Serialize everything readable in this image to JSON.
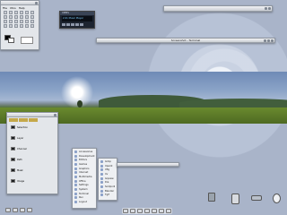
{
  "wallpaper": {
    "accent": "#c3cbe0"
  },
  "gimp_toolbox": {
    "menu": [
      "File",
      "Xtns",
      "Help"
    ],
    "icons": [
      "select-rect-icon",
      "select-ellipse-icon",
      "lasso-icon",
      "magic-wand-icon",
      "scissors-icon",
      "paths-icon",
      "zoom-icon",
      "measure-icon",
      "move-icon",
      "crop-icon",
      "rotate-icon",
      "flip-icon",
      "text-icon",
      "color-picker-icon",
      "bucket-icon",
      "gradient-icon",
      "pencil-icon",
      "brush-icon",
      "eraser-icon",
      "airbrush-icon",
      "clone-icon",
      "smudge-icon",
      "dodge-icon",
      "ink-icon"
    ]
  },
  "media_player": {
    "title": "XMMS",
    "display": "2:41 Music Player"
  },
  "top_bar_window": {
    "title": ""
  },
  "wide_window": {
    "title": "Screenshot - Terminal"
  },
  "left_panel": {
    "tabs": [
      "",
      "",
      ""
    ],
    "rows": [
      "Selection",
      "Layer",
      "Channel",
      "Path",
      "Mask",
      "Image"
    ]
  },
  "start_menu": {
    "items": [
      "Accessories",
      "Development",
      "Editors",
      "Games",
      "Graphics",
      "Internet",
      "Multimedia",
      "Office",
      "Settings",
      "System",
      "Terminal",
      "Run",
      "Logout"
    ]
  },
  "submenu": {
    "items": [
      "Gimp",
      "Xpaint",
      "Xfig",
      "Xv",
      "Gqview",
      "Dia",
      "Sodipodi",
      "Blender",
      "Tgif"
    ]
  },
  "small_window": {
    "title": ""
  },
  "dock": {
    "items": [
      "terminal-icon",
      "browser-icon",
      "file-manager-icon",
      "settings-icon",
      "editor-icon",
      "mail-icon",
      "music-icon"
    ]
  },
  "taskbar_left": {
    "items": [
      "desktop-icon",
      "desktop-icon",
      "desktop-icon",
      "desktop-icon"
    ]
  }
}
